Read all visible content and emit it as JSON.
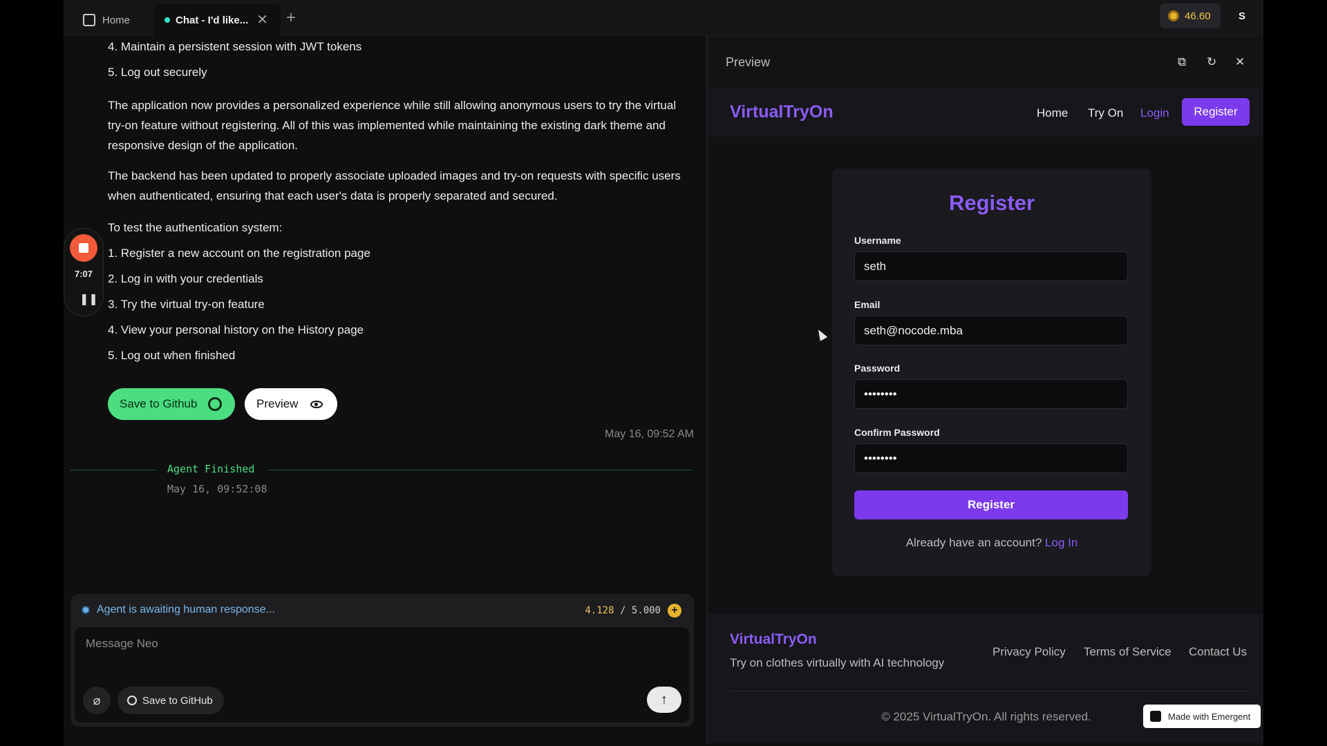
{
  "browser": {
    "tabs": [
      {
        "label": "Home"
      },
      {
        "label": "Chat - I'd like..."
      }
    ],
    "credits": "46.60",
    "avatar_initial": "S"
  },
  "chat": {
    "lines_top": [
      "4. Maintain a persistent session with JWT tokens",
      "5. Log out securely"
    ],
    "paragraph1": "The application now provides a personalized experience while still allowing anonymous users to try the virtual try-on feature without registering. All of this was implemented while maintaining the existing dark theme and responsive design of the application.",
    "paragraph2": "The backend has been updated to properly associate uploaded images and try-on requests with specific users when authenticated, ensuring that each user's data is properly separated and secured.",
    "test_heading": "To test the authentication system:",
    "test_steps": [
      "1. Register a new account on the registration page",
      "2. Log in with your credentials",
      "3. Try the virtual try-on feature",
      "4. View your personal history on the History page",
      "5. Log out when finished"
    ],
    "recorder_time": "7:07",
    "save_github_label": "Save to Github",
    "preview_label": "Preview",
    "message_timestamp": "May 16, 09:52 AM",
    "agent_finished": "Agent Finished",
    "agent_finished_time": "May 16, 09:52:08",
    "status": "Agent is awaiting human response...",
    "tokens_used": "4.128",
    "tokens_total": "/ 5.000",
    "input_placeholder": "Message Neo",
    "save_github_small": "Save to GitHub"
  },
  "preview": {
    "title": "Preview",
    "site": {
      "brand": "VirtualTryOn",
      "nav": [
        "Home",
        "Try On",
        "Login",
        "Register"
      ],
      "form": {
        "title": "Register",
        "username_label": "Username",
        "username_value": "seth",
        "email_label": "Email",
        "email_value": "seth@nocode.mba",
        "password_label": "Password",
        "password_value": "••••••••",
        "confirm_label": "Confirm Password",
        "confirm_value": "••••••••",
        "submit": "Register",
        "have_account": "Already have an account?",
        "login_link": "Log In"
      },
      "footer": {
        "brand": "VirtualTryOn",
        "tagline": "Try on clothes virtually with AI technology",
        "links": [
          "Privacy Policy",
          "Terms of Service",
          "Contact Us"
        ],
        "copyright": "© 2025 VirtualTryOn. All rights reserved.",
        "badge": "Made with Emergent"
      }
    }
  },
  "colors": {
    "accent_purple": "#8b5cf6",
    "button_purple": "#7c3aed",
    "github_green": "#4ade80",
    "record_red": "#f25a3a"
  }
}
